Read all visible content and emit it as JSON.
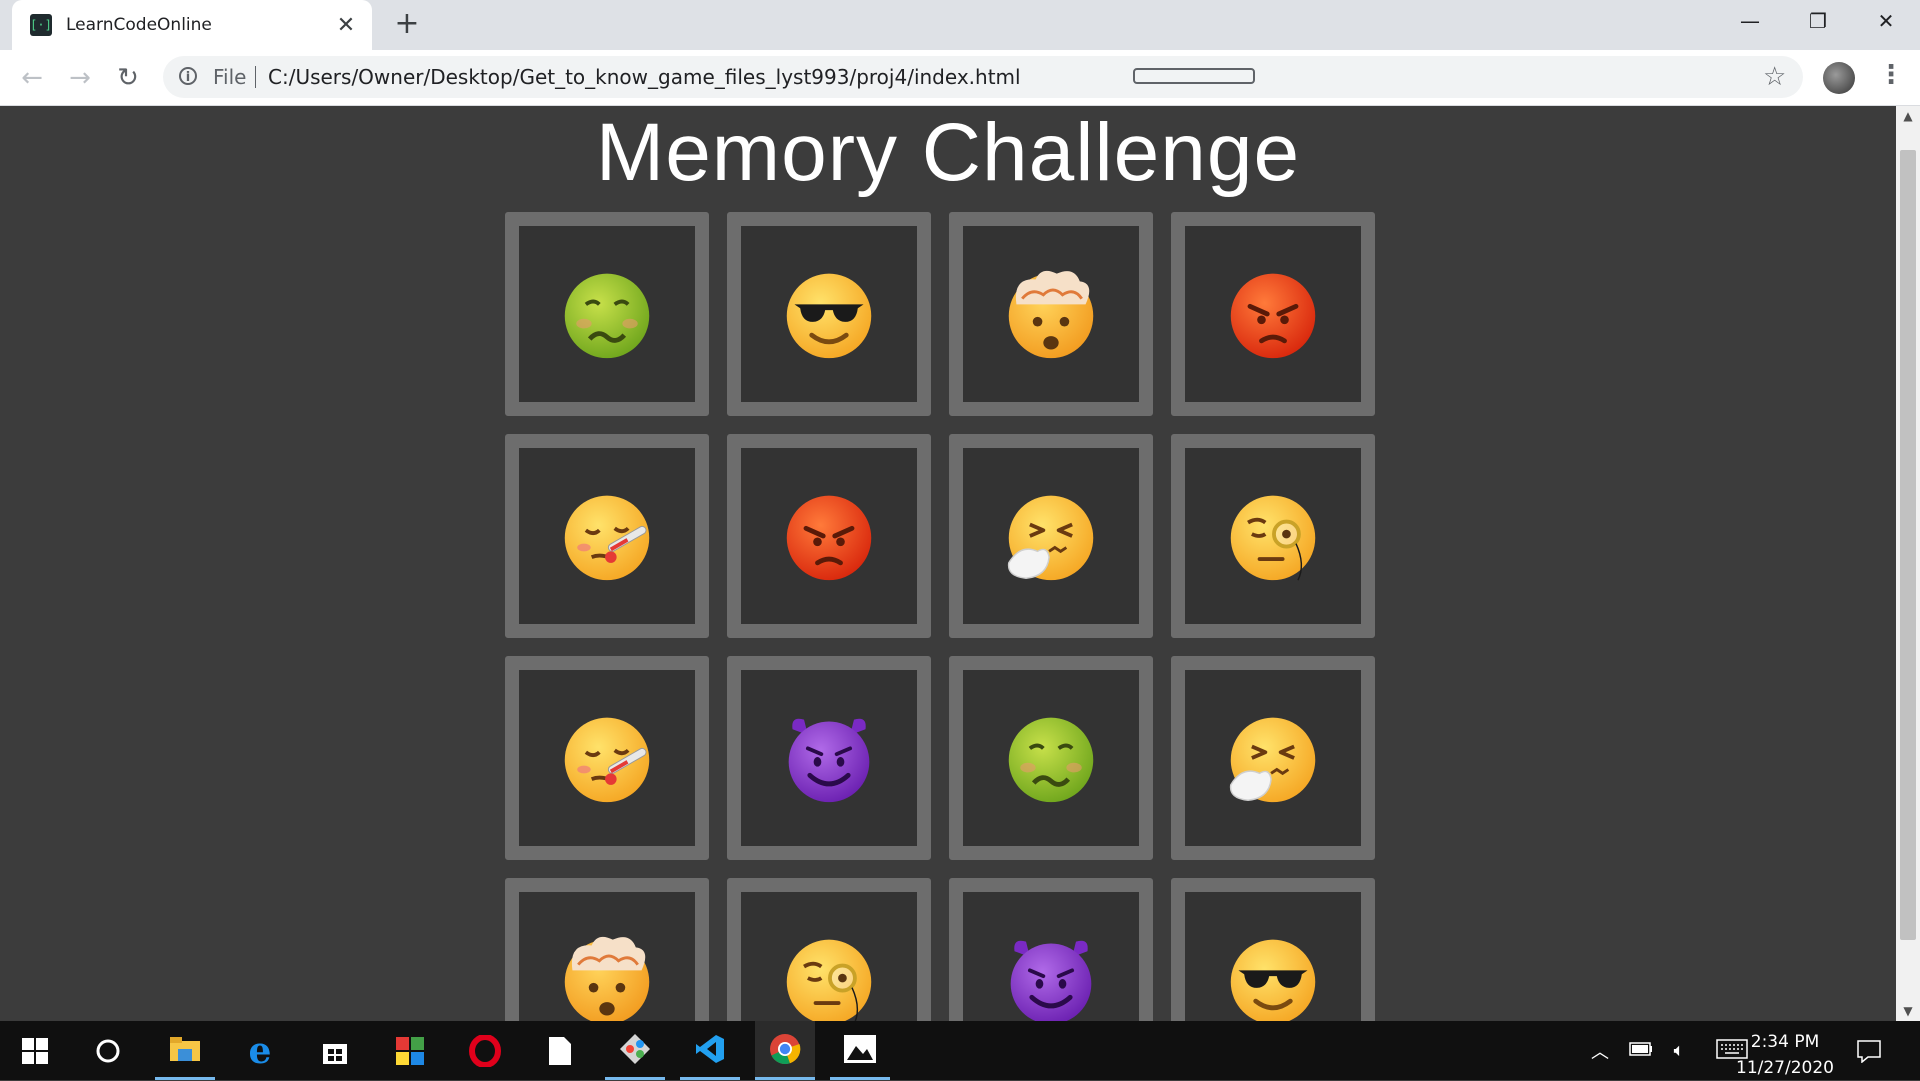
{
  "browser": {
    "tab_title": "LearnCodeOnline",
    "favicon_glyph": "[·]",
    "close_glyph": "✕",
    "newtab_glyph": "+",
    "file_label": "File",
    "url": "C:/Users/Owner/Desktop/Get_to_know_game_files_lyst993/proj4/index.html",
    "minimize_glyph": "—",
    "restore_glyph": "❐",
    "window_close_glyph": "✕",
    "back_glyph": "←",
    "forward_glyph": "→",
    "reload_glyph": "↻",
    "star_glyph": "☆",
    "menu_glyph": "⋮"
  },
  "page": {
    "title": "Memory Challenge",
    "cards": [
      {
        "emoji": "nauseated-face"
      },
      {
        "emoji": "sunglasses-face"
      },
      {
        "emoji": "exploding-head"
      },
      {
        "emoji": "angry-face"
      },
      {
        "emoji": "face-with-thermometer"
      },
      {
        "emoji": "angry-face"
      },
      {
        "emoji": "sneezing-face"
      },
      {
        "emoji": "face-with-monocle"
      },
      {
        "emoji": "face-with-thermometer"
      },
      {
        "emoji": "smiling-devil"
      },
      {
        "emoji": "nauseated-face"
      },
      {
        "emoji": "sneezing-face"
      },
      {
        "emoji": "exploding-head"
      },
      {
        "emoji": "face-with-monocle"
      },
      {
        "emoji": "smiling-devil"
      },
      {
        "emoji": "sunglasses-face"
      }
    ]
  },
  "taskbar": {
    "apps": [
      "windows-start",
      "cortana-search",
      "file-explorer",
      "edge",
      "microsoft-store",
      "colorful-app",
      "opera",
      "notepad-file",
      "git-tool",
      "vscode",
      "chrome",
      "photos"
    ],
    "time": "2:34 PM",
    "date": "11/27/2020"
  },
  "colors": {
    "page_bg": "#3c3c3c",
    "card_border": "#6d6d6d",
    "card_face": "#333333",
    "title": "#ffffff"
  }
}
